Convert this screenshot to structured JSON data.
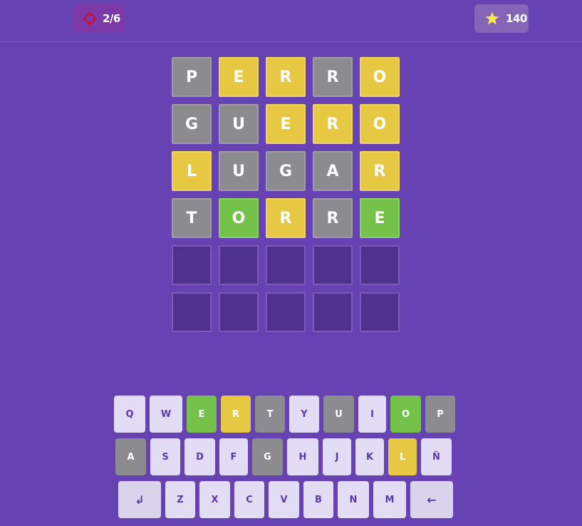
{
  "header": {
    "attempts": "2/6",
    "score": "140",
    "colors": {
      "attempts_bg": "#7b3aa8",
      "score_bg": "#8565b8",
      "target_icon": "#c8102e",
      "star_icon": "#f5e94d"
    }
  },
  "board": [
    [
      {
        "letter": "P",
        "state": "absent"
      },
      {
        "letter": "E",
        "state": "present"
      },
      {
        "letter": "R",
        "state": "present"
      },
      {
        "letter": "R",
        "state": "absent"
      },
      {
        "letter": "O",
        "state": "present"
      }
    ],
    [
      {
        "letter": "G",
        "state": "absent"
      },
      {
        "letter": "U",
        "state": "absent"
      },
      {
        "letter": "E",
        "state": "present"
      },
      {
        "letter": "R",
        "state": "present"
      },
      {
        "letter": "O",
        "state": "present"
      }
    ],
    [
      {
        "letter": "L",
        "state": "present"
      },
      {
        "letter": "U",
        "state": "absent"
      },
      {
        "letter": "G",
        "state": "absent"
      },
      {
        "letter": "A",
        "state": "absent"
      },
      {
        "letter": "R",
        "state": "present"
      }
    ],
    [
      {
        "letter": "T",
        "state": "absent"
      },
      {
        "letter": "O",
        "state": "correct"
      },
      {
        "letter": "R",
        "state": "present"
      },
      {
        "letter": "R",
        "state": "absent"
      },
      {
        "letter": "E",
        "state": "correct"
      }
    ],
    [
      {
        "letter": "",
        "state": "empty"
      },
      {
        "letter": "",
        "state": "empty"
      },
      {
        "letter": "",
        "state": "empty"
      },
      {
        "letter": "",
        "state": "empty"
      },
      {
        "letter": "",
        "state": "empty"
      }
    ],
    [
      {
        "letter": "",
        "state": "empty"
      },
      {
        "letter": "",
        "state": "empty"
      },
      {
        "letter": "",
        "state": "empty"
      },
      {
        "letter": "",
        "state": "empty"
      },
      {
        "letter": "",
        "state": "empty"
      }
    ]
  ],
  "keyboard": {
    "row1": [
      {
        "label": "Q",
        "state": "unused"
      },
      {
        "label": "W",
        "state": "unused"
      },
      {
        "label": "E",
        "state": "correct"
      },
      {
        "label": "R",
        "state": "present"
      },
      {
        "label": "T",
        "state": "absent"
      },
      {
        "label": "Y",
        "state": "unused"
      },
      {
        "label": "U",
        "state": "absent"
      },
      {
        "label": "I",
        "state": "unused"
      },
      {
        "label": "O",
        "state": "correct"
      },
      {
        "label": "P",
        "state": "absent"
      }
    ],
    "row2": [
      {
        "label": "A",
        "state": "absent"
      },
      {
        "label": "S",
        "state": "unused"
      },
      {
        "label": "D",
        "state": "unused"
      },
      {
        "label": "F",
        "state": "unused"
      },
      {
        "label": "G",
        "state": "absent"
      },
      {
        "label": "H",
        "state": "unused"
      },
      {
        "label": "J",
        "state": "unused"
      },
      {
        "label": "K",
        "state": "unused"
      },
      {
        "label": "L",
        "state": "present"
      },
      {
        "label": "Ñ",
        "state": "unused"
      }
    ],
    "row3": [
      {
        "label": "↲",
        "state": "unused",
        "kind": "enter"
      },
      {
        "label": "Z",
        "state": "unused"
      },
      {
        "label": "X",
        "state": "unused"
      },
      {
        "label": "C",
        "state": "unused"
      },
      {
        "label": "V",
        "state": "unused"
      },
      {
        "label": "B",
        "state": "unused"
      },
      {
        "label": "N",
        "state": "unused"
      },
      {
        "label": "M",
        "state": "unused"
      },
      {
        "label": "←",
        "state": "unused",
        "kind": "backspace"
      }
    ]
  }
}
